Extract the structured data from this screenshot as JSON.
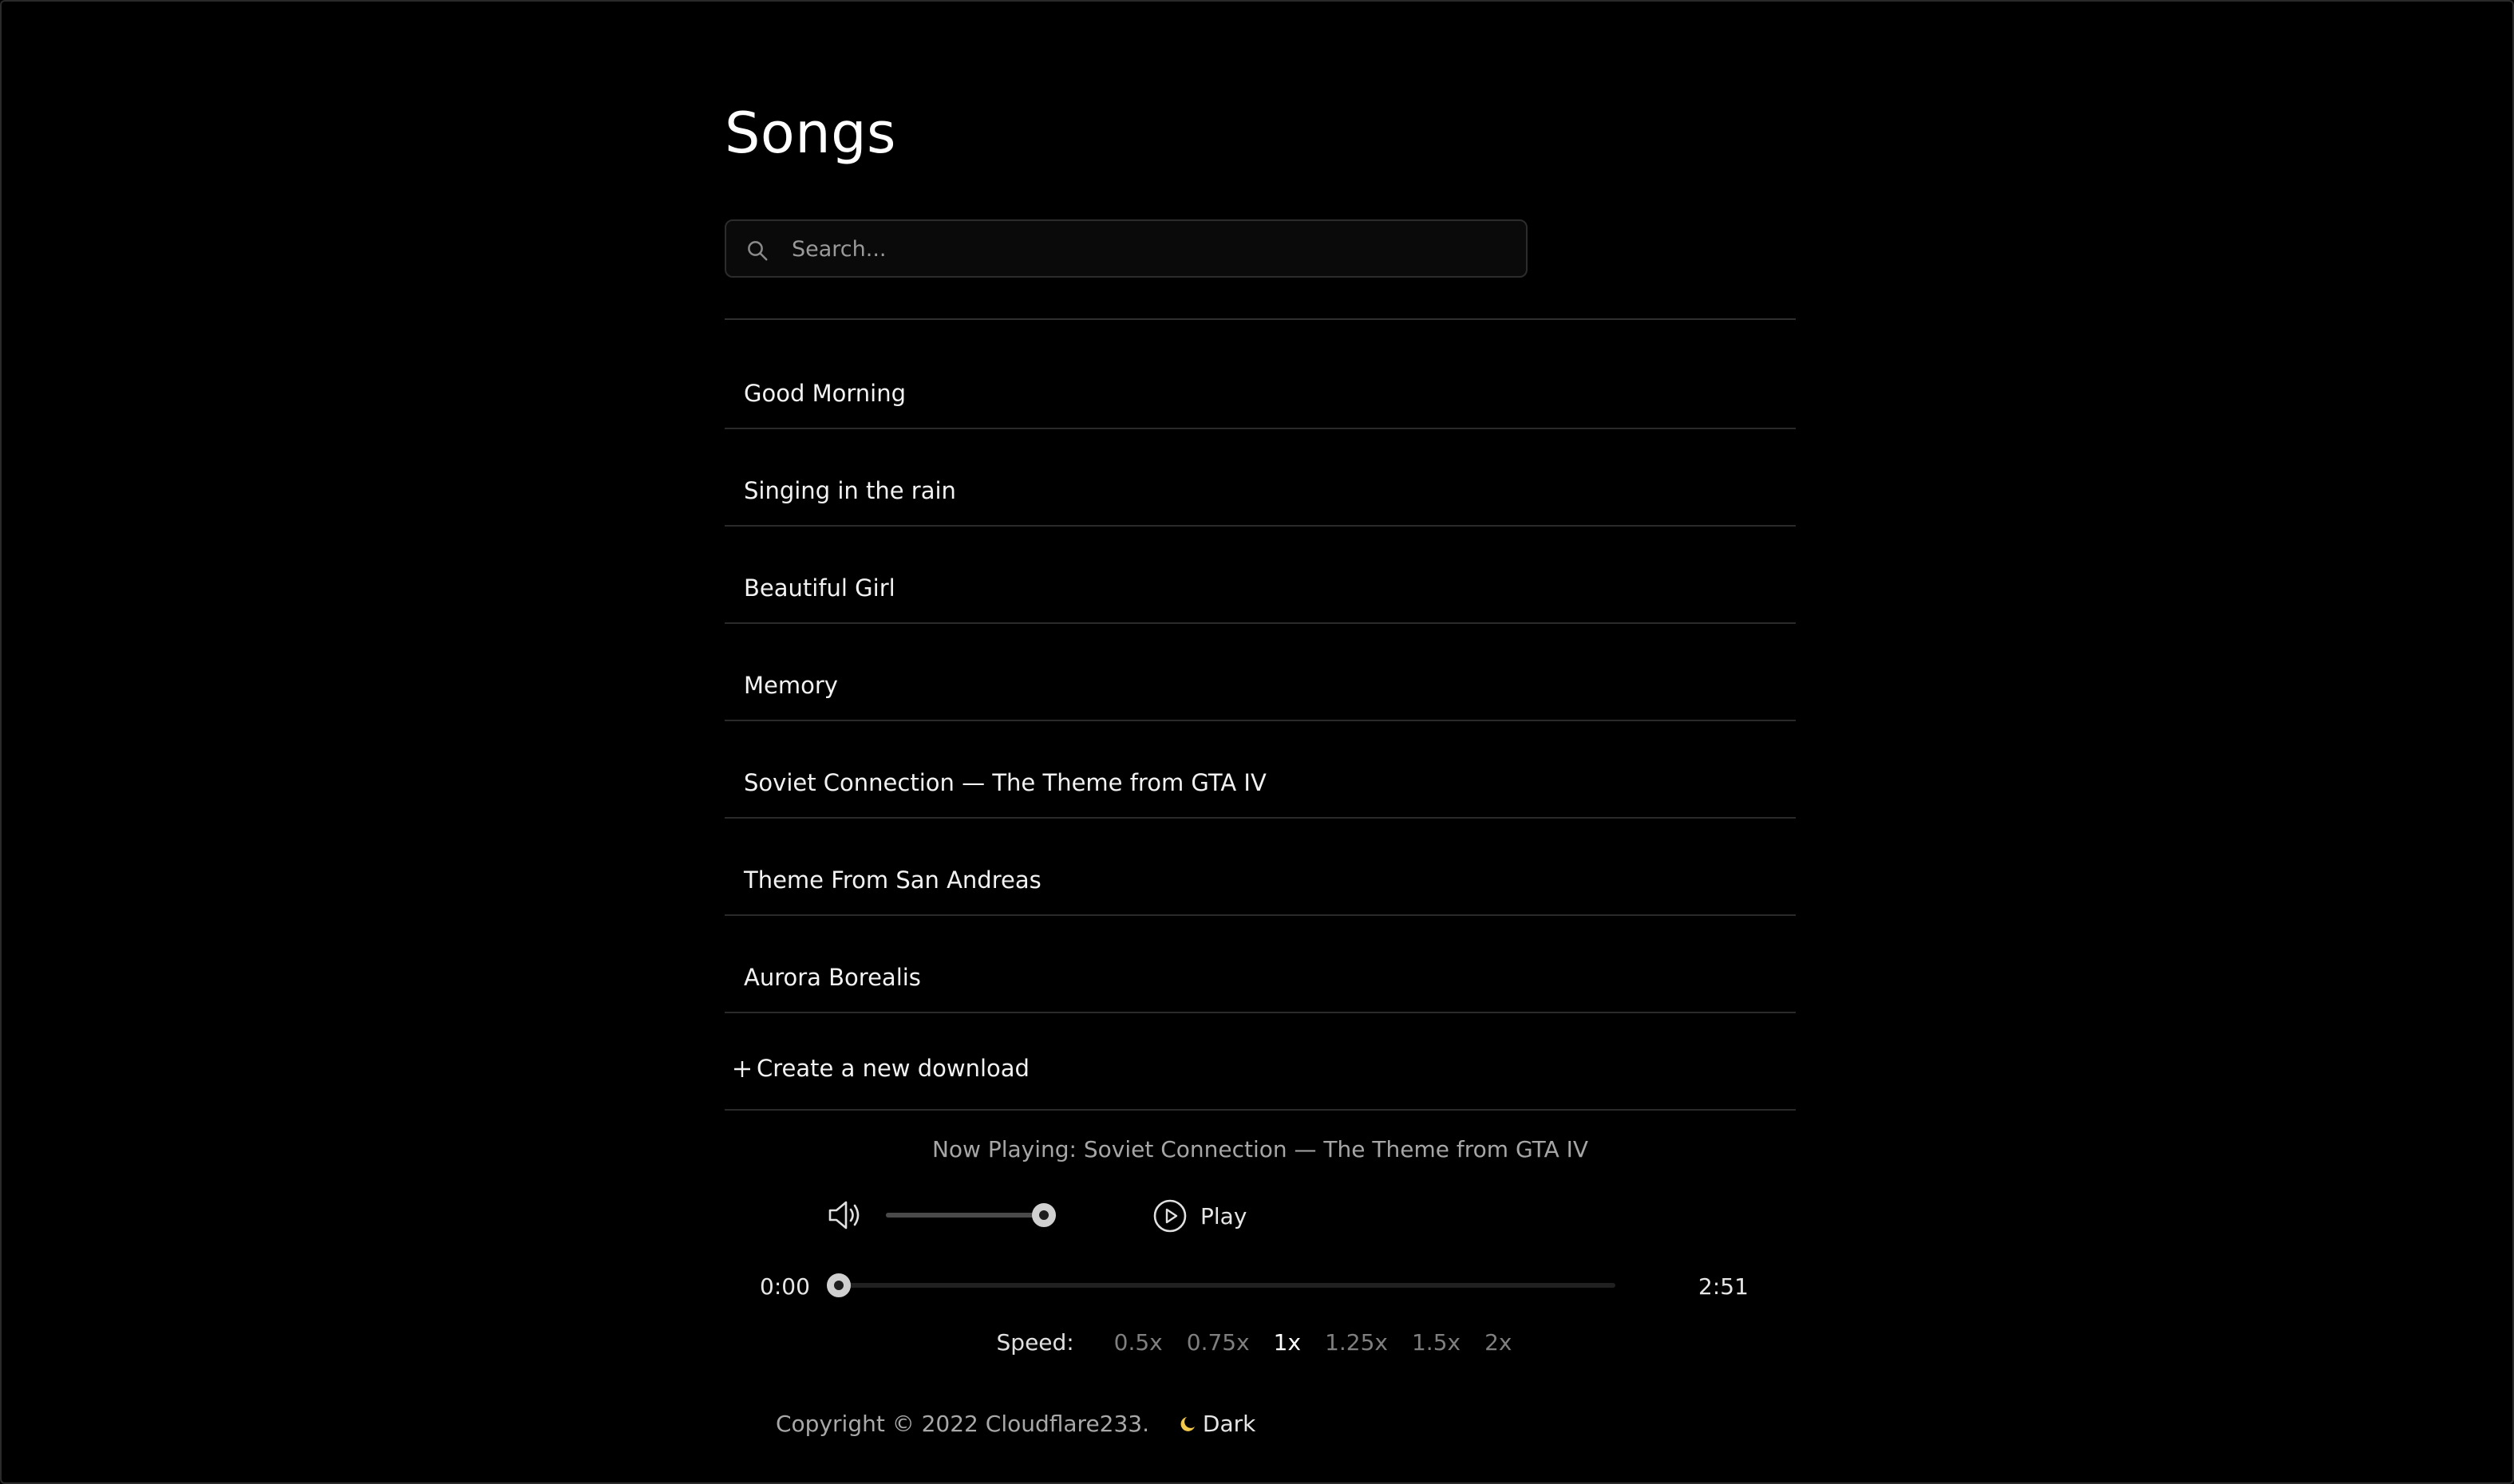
{
  "page": {
    "title": "Songs"
  },
  "search": {
    "placeholder": "Search..."
  },
  "songs": [
    {
      "title": "Good Morning"
    },
    {
      "title": "Singing in the rain"
    },
    {
      "title": "Beautiful Girl"
    },
    {
      "title": "Memory"
    },
    {
      "title": "Soviet Connection — The Theme from GTA IV"
    },
    {
      "title": "Theme From San Andreas"
    },
    {
      "title": "Aurora Borealis"
    }
  ],
  "create": {
    "label": "Create a new download",
    "icon": "plus-icon"
  },
  "player": {
    "now_playing_prefix": "Now Playing: ",
    "now_playing_title": "Soviet Connection — The Theme from GTA IV",
    "volume_level": 0.93,
    "play_label": "Play",
    "current_time": "0:00",
    "duration": "2:51",
    "progress_fraction": 0.0,
    "speed_label": "Speed:",
    "speed_options": [
      "0.5x",
      "0.75x",
      "1x",
      "1.25x",
      "1.5x",
      "2x"
    ],
    "speed_selected": "1x"
  },
  "footer": {
    "copyright": "Copyright © 2022 Cloudflare233.",
    "theme_label": "Dark",
    "theme_icon": "moon-icon"
  },
  "colors": {
    "background": "#000000",
    "text": "#f0f0f0",
    "muted_text": "#a6a6a6",
    "divider": "#2a2a2a",
    "moon": "#f2c94c"
  }
}
